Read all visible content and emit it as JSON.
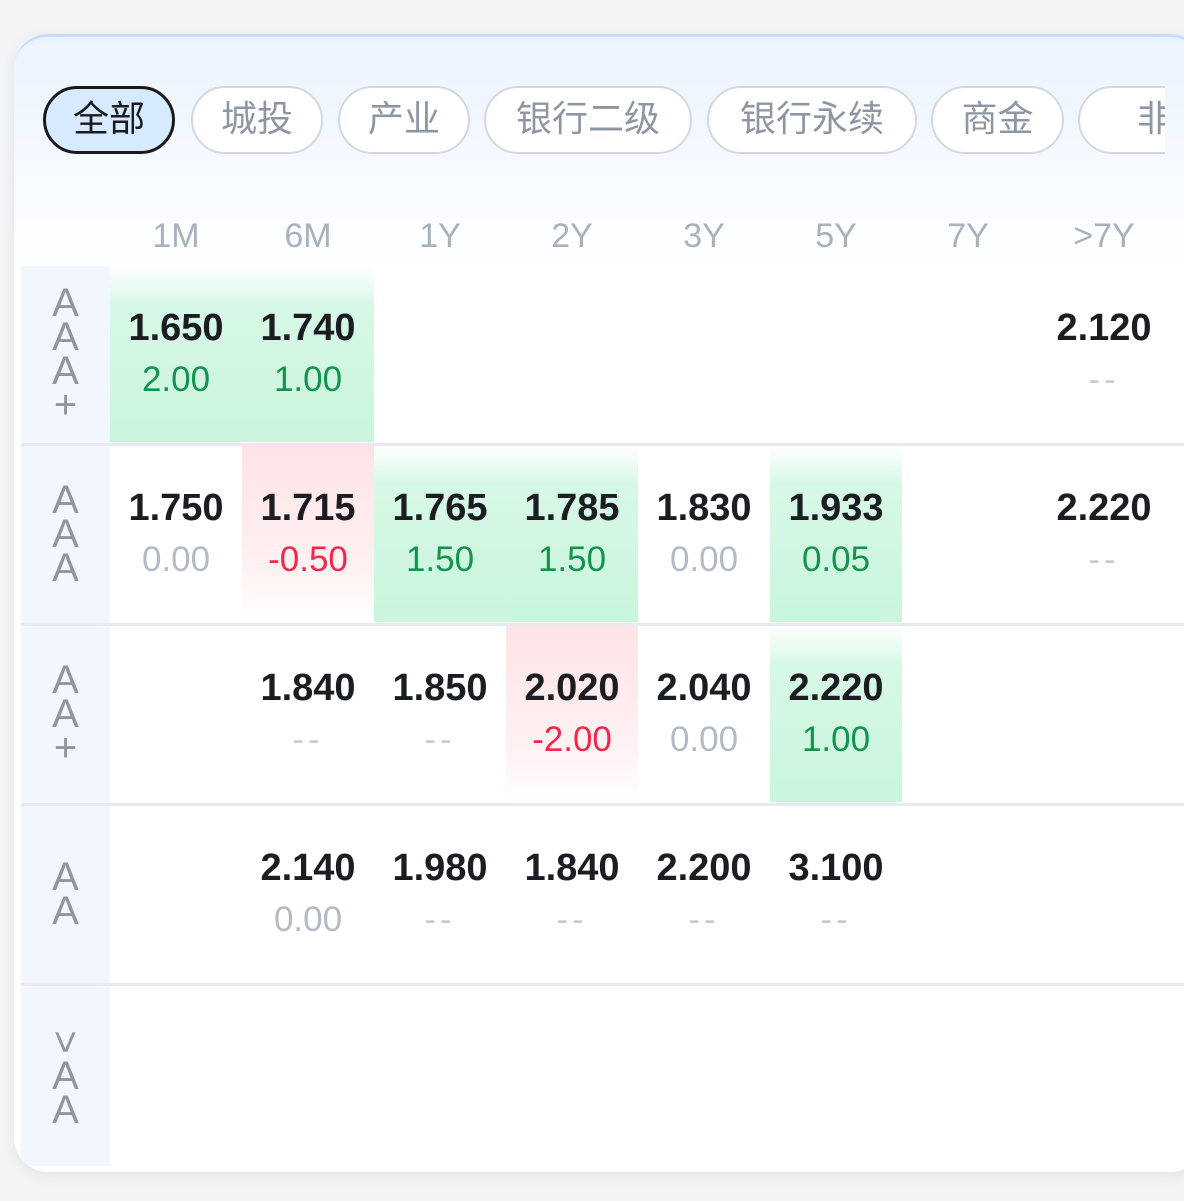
{
  "tabs": [
    {
      "label": "全部",
      "active": true
    },
    {
      "label": "城投",
      "active": false
    },
    {
      "label": "产业",
      "active": false
    },
    {
      "label": "银行二级",
      "active": false
    },
    {
      "label": "银行永续",
      "active": false
    },
    {
      "label": "商金",
      "active": false
    },
    {
      "label": "非二",
      "active": false
    }
  ],
  "columns": [
    "1M",
    "6M",
    "1Y",
    "2Y",
    "3Y",
    "5Y",
    "7Y",
    ">7Y"
  ],
  "rows": [
    {
      "label": "AAA+",
      "cells": [
        {
          "col": "1M",
          "rate": "1.650",
          "change": "2.00",
          "trend": "up"
        },
        {
          "col": "6M",
          "rate": "1.740",
          "change": "1.00",
          "trend": "up"
        },
        {
          "col": ">7Y",
          "rate": "2.120",
          "change": "--",
          "trend": "none"
        }
      ]
    },
    {
      "label": "AAA",
      "cells": [
        {
          "col": "1M",
          "rate": "1.750",
          "change": "0.00",
          "trend": "flat"
        },
        {
          "col": "6M",
          "rate": "1.715",
          "change": "-0.50",
          "trend": "down"
        },
        {
          "col": "1Y",
          "rate": "1.765",
          "change": "1.50",
          "trend": "up"
        },
        {
          "col": "2Y",
          "rate": "1.785",
          "change": "1.50",
          "trend": "up"
        },
        {
          "col": "3Y",
          "rate": "1.830",
          "change": "0.00",
          "trend": "flat"
        },
        {
          "col": "5Y",
          "rate": "1.933",
          "change": "0.05",
          "trend": "up"
        },
        {
          "col": ">7Y",
          "rate": "2.220",
          "change": "--",
          "trend": "none"
        }
      ]
    },
    {
      "label": "AA+",
      "cells": [
        {
          "col": "6M",
          "rate": "1.840",
          "change": "--",
          "trend": "none"
        },
        {
          "col": "1Y",
          "rate": "1.850",
          "change": "--",
          "trend": "none"
        },
        {
          "col": "2Y",
          "rate": "2.020",
          "change": "-2.00",
          "trend": "down"
        },
        {
          "col": "3Y",
          "rate": "2.040",
          "change": "0.00",
          "trend": "flat"
        },
        {
          "col": "5Y",
          "rate": "2.220",
          "change": "1.00",
          "trend": "up"
        }
      ]
    },
    {
      "label": "AA",
      "cells": [
        {
          "col": "6M",
          "rate": "2.140",
          "change": "0.00",
          "trend": "flat"
        },
        {
          "col": "1Y",
          "rate": "1.980",
          "change": "--",
          "trend": "none"
        },
        {
          "col": "2Y",
          "rate": "1.840",
          "change": "--",
          "trend": "none"
        },
        {
          "col": "3Y",
          "rate": "2.200",
          "change": "--",
          "trend": "none"
        },
        {
          "col": "5Y",
          "rate": "3.100",
          "change": "--",
          "trend": "none"
        }
      ]
    },
    {
      "label": "<AA",
      "cells": []
    }
  ],
  "colors": {
    "up": "#11944b",
    "down": "#f0284a",
    "flat": "#b3bac5",
    "active_tab_bg": "#d6ebff"
  }
}
